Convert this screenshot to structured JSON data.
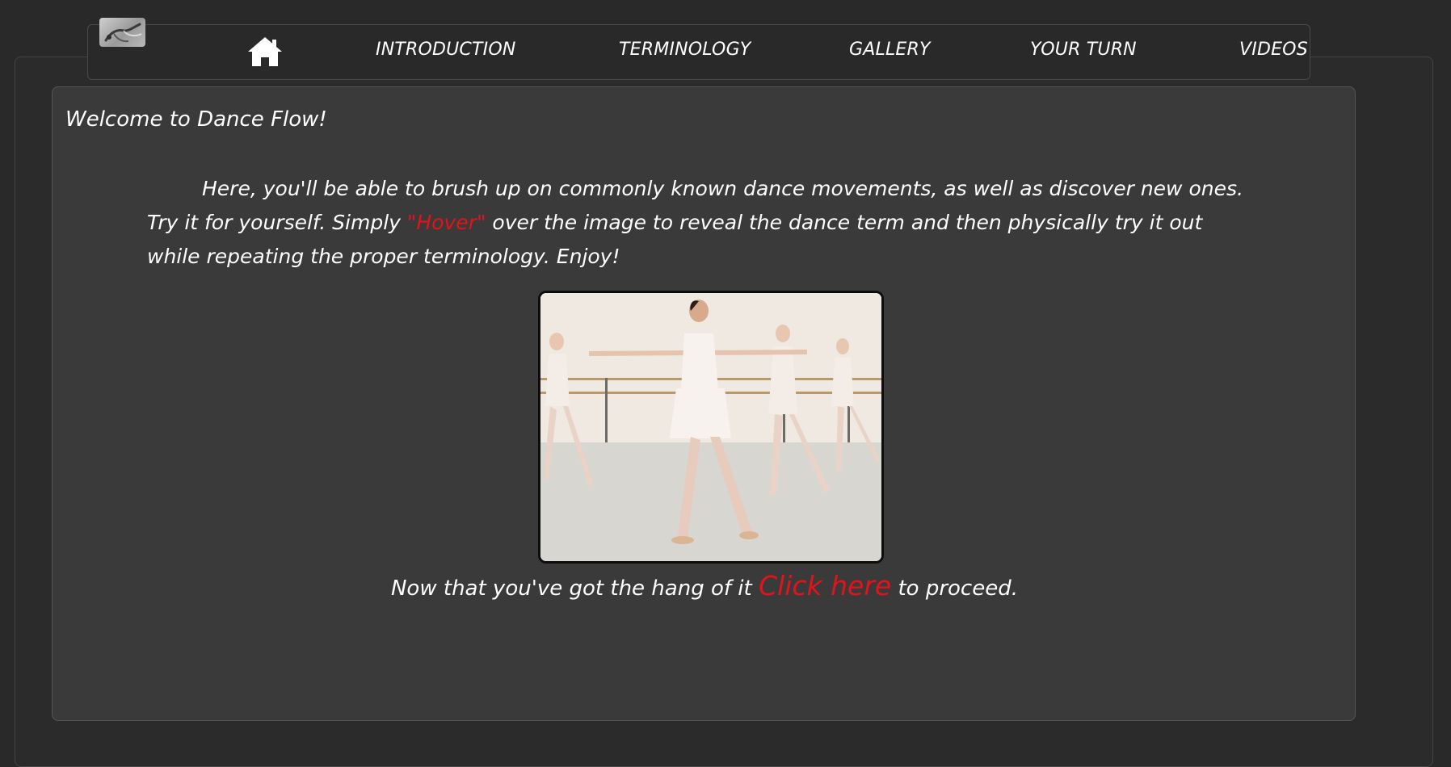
{
  "nav": {
    "logo_icon": "dancer-logo-icon",
    "home_icon": "home-icon",
    "items": [
      {
        "label": "INTRODUCTION"
      },
      {
        "label": "TERMINOLOGY"
      },
      {
        "label": "GALLERY"
      },
      {
        "label": "YOUR TURN"
      },
      {
        "label": "VIDEOS"
      }
    ]
  },
  "main": {
    "welcome": "Welcome to Dance Flow!",
    "intro_before": "Here, you'll be able to brush up on commonly known dance movements, as well as discover new ones. Try it for yourself. Simply ",
    "intro_highlight": "\"Hover\"",
    "intro_after": " over the image to reveal the dance term and then physically try it out while repeating the proper terminology. Enjoy!",
    "proceed_before": "Now that you've got the hang of it ",
    "proceed_link": "Click here",
    "proceed_after": " to proceed."
  },
  "colors": {
    "background": "#292929",
    "panel": "#3b3a3b",
    "accent_red": "#e3121b",
    "text": "#ffffff"
  }
}
